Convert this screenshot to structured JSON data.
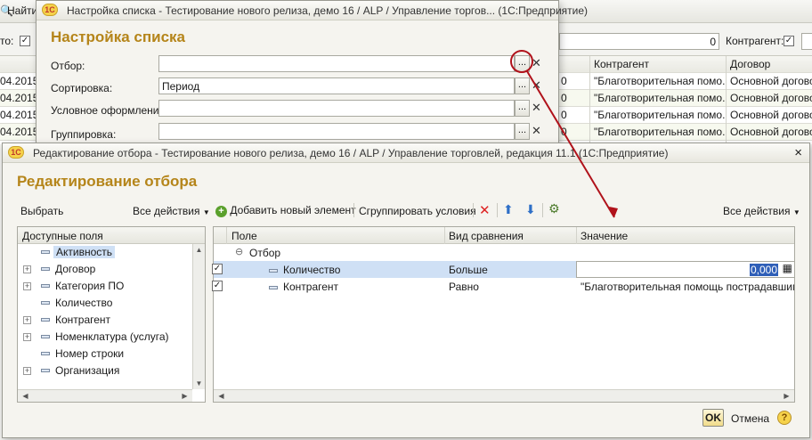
{
  "background": {
    "toolbar_find": "Найти...",
    "filter_label_left": "то:",
    "number_value": "0",
    "counterparty_label": "Контрагент:",
    "columns": {
      "counterparty": "Контрагент",
      "contract": "Договор"
    },
    "rows": [
      {
        "date": "04.2015",
        "num": "0",
        "counterparty": "\"Благотворительная помо...",
        "contract": "Основной договор"
      },
      {
        "date": "04.2015",
        "num": "0",
        "counterparty": "\"Благотворительная помо...",
        "contract": "Основной договор"
      },
      {
        "date": "04.2015",
        "num": "0",
        "counterparty": "\"Благотворительная помо...",
        "contract": "Основной договор"
      },
      {
        "date": "04.2015",
        "num": "0",
        "counterparty": "\"Благотворительная помо...",
        "contract": "Основной договор"
      }
    ]
  },
  "list_settings": {
    "window_title": "Настройка списка - Тестирование нового релиза, демо 16 / ALP / Управление торгов...  (1С:Предприятие)",
    "heading": "Настройка списка",
    "fields": [
      {
        "label": "Отбор:",
        "value": ""
      },
      {
        "label": "Сортировка:",
        "value": "Период"
      },
      {
        "label": "Условное оформление:",
        "value": ""
      },
      {
        "label": "Группировка:",
        "value": ""
      }
    ],
    "dots_label": "...",
    "clear_label": "✕"
  },
  "filter_edit": {
    "window_title": "Редактирование отбора - Тестирование нового релиза, демо 16 / ALP / Управление торговлей, редакция 11.1  (1С:Предприятие)",
    "heading": "Редактирование отбора",
    "toolbar_left": {
      "select": "Выбрать",
      "all_actions": "Все действия"
    },
    "toolbar_right": {
      "add_element": "Добавить новый элемент",
      "group_conditions": "Сгруппировать условия",
      "all_actions": "Все действия"
    },
    "available_fields": {
      "header": "Доступные поля",
      "items": [
        {
          "label": "Активность",
          "expandable": false,
          "selected": true
        },
        {
          "label": "Договор",
          "expandable": true,
          "selected": false
        },
        {
          "label": "Категория ПО",
          "expandable": true,
          "selected": false
        },
        {
          "label": "Количество",
          "expandable": false,
          "selected": false
        },
        {
          "label": "Контрагент",
          "expandable": true,
          "selected": false
        },
        {
          "label": "Номенклатура (услуга)",
          "expandable": true,
          "selected": false
        },
        {
          "label": "Номер строки",
          "expandable": false,
          "selected": false
        },
        {
          "label": "Организация",
          "expandable": true,
          "selected": false
        }
      ]
    },
    "conditions": {
      "columns": {
        "field": "Поле",
        "comparison": "Вид сравнения",
        "value": "Значение"
      },
      "group_label": "Отбор",
      "rows": [
        {
          "checked": true,
          "field": "Количество",
          "comparison": "Больше",
          "value": "0,000",
          "selected": true
        },
        {
          "checked": true,
          "field": "Контрагент",
          "comparison": "Равно",
          "value": "\"Благотворительная помощь пострадавшим...",
          "selected": false
        }
      ]
    },
    "footer": {
      "ok": "OK",
      "cancel": "Отмена",
      "help": "?"
    },
    "accent_color": "#b5851a"
  }
}
